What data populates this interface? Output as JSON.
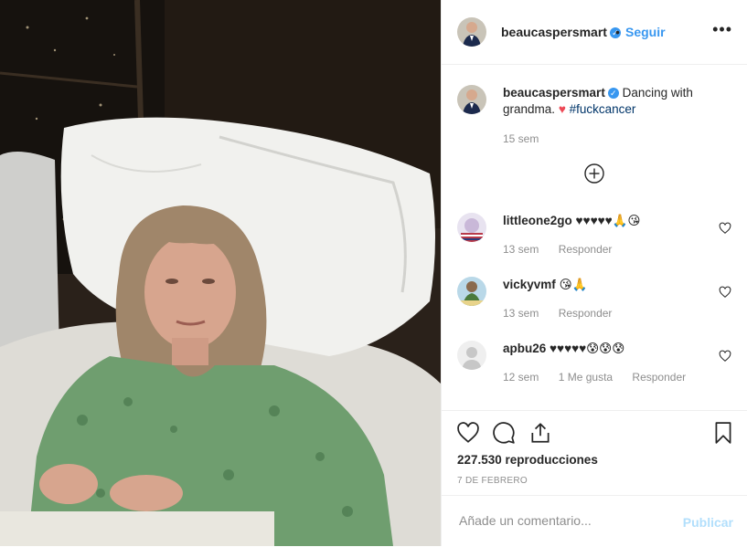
{
  "post": {
    "username": "beaucaspersmart",
    "follow_label": "Seguir",
    "dot": "•",
    "more_label": "•••",
    "caption_text": "Dancing with grandma.",
    "caption_emoji": "♥",
    "caption_tag": "#fuckcancer",
    "caption_time": "15 sem"
  },
  "comments": [
    {
      "username": "littleone2go",
      "text": "♥♥♥♥♥🙏😘",
      "time": "13 sem",
      "likes": "",
      "reply": "Responder"
    },
    {
      "username": "vickyvmf",
      "text": "😘🙏",
      "time": "13 sem",
      "likes": "",
      "reply": "Responder"
    },
    {
      "username": "apbu26",
      "text": "♥♥♥♥♥😰😰😰",
      "time": "12 sem",
      "likes": "1 Me gusta",
      "reply": "Responder"
    }
  ],
  "stats": {
    "views": "227.530 reproducciones",
    "date": "7 DE FEBRERO"
  },
  "composer": {
    "placeholder": "Añade un comentario...",
    "publish_label": "Publicar"
  },
  "icons": {
    "verified": "verified-badge-icon",
    "like": "heart-icon",
    "comment": "comment-icon",
    "share": "share-icon",
    "save": "bookmark-icon",
    "load_more": "plus-circle-icon"
  },
  "colors": {
    "link_blue": "#3897f0",
    "muted": "#8e8e8e",
    "heart_red": "#ed4956",
    "publish_disabled": "#b2dffc"
  }
}
